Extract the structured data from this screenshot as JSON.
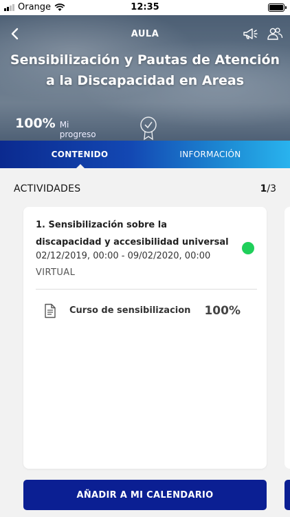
{
  "status_bar": {
    "carrier": "Orange",
    "time": "12:35"
  },
  "header": {
    "title": "AULA"
  },
  "course": {
    "title": "Sensibilización y Pautas de Atención a la Discapacidad en Areas",
    "progress_value": "100%",
    "progress_label": "Mi progreso",
    "progress_fraction": 1.0
  },
  "tabs": [
    {
      "label": "CONTENIDO",
      "active": true
    },
    {
      "label": "INFORMACIÓN",
      "active": false
    }
  ],
  "activities": {
    "section_title": "ACTIVIDADES",
    "pager_current": "1",
    "pager_total": "/3",
    "items": [
      {
        "name": "1. Sensibilización sobre la discapacidad y accesibilidad universal",
        "dates": "02/12/2019, 00:00 - 09/02/2020, 00:00",
        "mode": "VIRTUAL",
        "status_color": "#1fcf5a",
        "resources": [
          {
            "name": "Curso de sensibilizacion",
            "percent": "100%",
            "icon": "document-icon"
          }
        ]
      }
    ]
  },
  "actions": {
    "calendar_label": "AÑADIR A MI CALENDARIO"
  },
  "colors": {
    "primary": "#0b1f93",
    "status_ok": "#1fcf5a"
  }
}
